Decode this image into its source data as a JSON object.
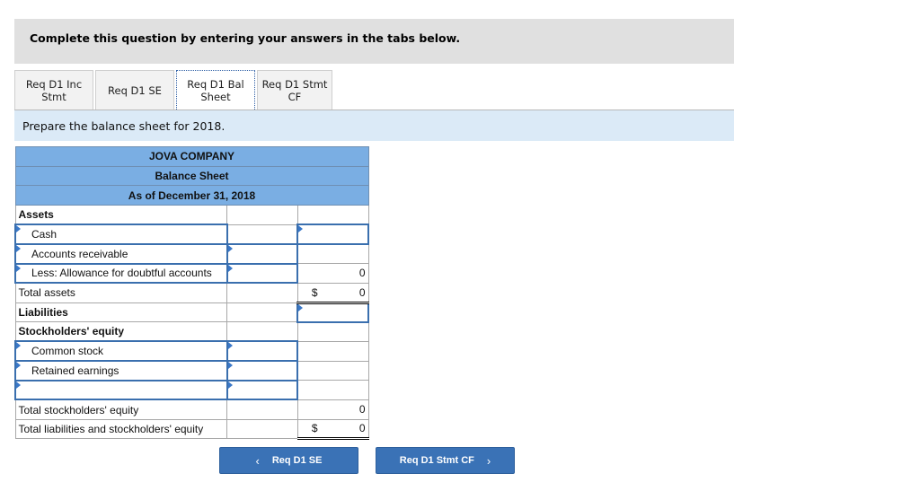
{
  "instruction": "Complete this question by entering your answers in the tabs below.",
  "tabs": [
    {
      "line1": "Req D1 Inc",
      "line2": "Stmt",
      "active": false
    },
    {
      "line1": "Req D1 SE",
      "line2": "",
      "active": false
    },
    {
      "line1": "Req D1 Bal",
      "line2": "Sheet",
      "active": true
    },
    {
      "line1": "Req D1 Stmt",
      "line2": "CF",
      "active": false
    }
  ],
  "prompt": "Prepare the balance sheet for 2018.",
  "balance_sheet": {
    "company": "JOVA COMPANY",
    "title": "Balance Sheet",
    "date": "As of December 31, 2018",
    "rows": {
      "assets": "Assets",
      "cash": "Cash",
      "accounts_receivable": "Accounts receivable",
      "allowance": "Less: Allowance for doubtful accounts",
      "allowance_value": "0",
      "total_assets": "Total assets",
      "total_assets_currency": "$",
      "total_assets_value": "0",
      "liabilities": "Liabilities",
      "se": "Stockholders' equity",
      "common_stock": "Common stock",
      "retained_earnings": "Retained earnings",
      "blank_row": "",
      "total_se": "Total stockholders' equity",
      "total_se_value": "0",
      "total_l_se": "Total liabilities and stockholders' equity",
      "total_l_se_currency": "$",
      "total_l_se_value": "0"
    }
  },
  "nav": {
    "prev_label": "Req D1 SE",
    "next_label": "Req D1 Stmt CF",
    "prev_icon": "‹",
    "next_icon": "›"
  }
}
